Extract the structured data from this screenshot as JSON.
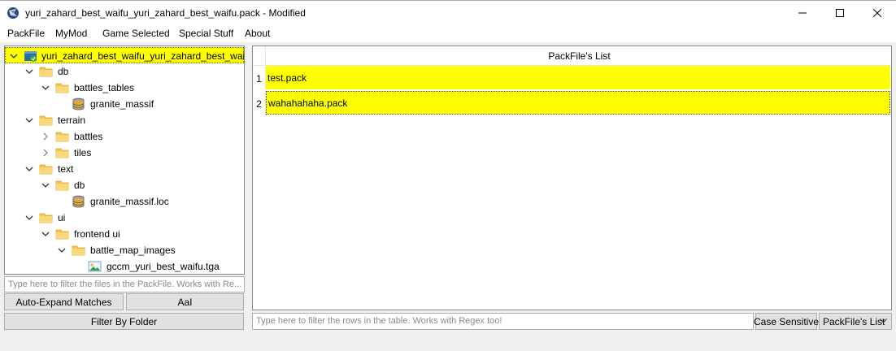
{
  "window": {
    "title": "yuri_zahard_best_waifu_yuri_zahard_best_waifu.pack - Modified"
  },
  "menu": {
    "items": [
      "PackFile",
      "MyMod",
      "Game Selected",
      "Special Stuff",
      "About"
    ]
  },
  "tree": {
    "items": [
      {
        "label": "yuri_zahard_best_waifu_yuri_zahard_best_wai...",
        "icon": "packfile-icon",
        "expanded": true
      },
      {
        "label": "db",
        "icon": "folder-icon",
        "expanded": true
      },
      {
        "label": "battles_tables",
        "icon": "folder-icon",
        "expanded": true
      },
      {
        "label": "granite_massif",
        "icon": "database-icon"
      },
      {
        "label": "terrain",
        "icon": "folder-icon",
        "expanded": true
      },
      {
        "label": "battles",
        "icon": "folder-icon",
        "expanded": false
      },
      {
        "label": "tiles",
        "icon": "folder-icon",
        "expanded": false
      },
      {
        "label": "text",
        "icon": "folder-icon",
        "expanded": true
      },
      {
        "label": "db",
        "icon": "folder-icon",
        "expanded": true
      },
      {
        "label": "granite_massif.loc",
        "icon": "database-icon"
      },
      {
        "label": "ui",
        "icon": "folder-icon",
        "expanded": true
      },
      {
        "label": "frontend ui",
        "icon": "folder-icon",
        "expanded": true
      },
      {
        "label": "battle_map_images",
        "icon": "folder-icon",
        "expanded": true
      },
      {
        "label": "gccm_yuri_best_waifu.tga",
        "icon": "image-icon"
      }
    ],
    "filter_placeholder": "Type here to filter the files in the PackFile. Works with Re...",
    "auto_expand_label": "Auto-Expand Matches",
    "case_label": "AaI",
    "filter_by_folder_label": "Filter By Folder"
  },
  "table": {
    "header": "PackFile's List",
    "rows": [
      {
        "num": "1",
        "value": "test.pack"
      },
      {
        "num": "2",
        "value": "wahahahaha.pack"
      }
    ],
    "filter_placeholder": "Type here to filter the rows in the table. Works with Regex too!",
    "case_sensitive_label": "Case Sensitive",
    "column_select_value": "PackFile's List"
  },
  "colors": {
    "highlight": "#ffff00",
    "folder": "#f5c64c",
    "border": "#828790"
  }
}
